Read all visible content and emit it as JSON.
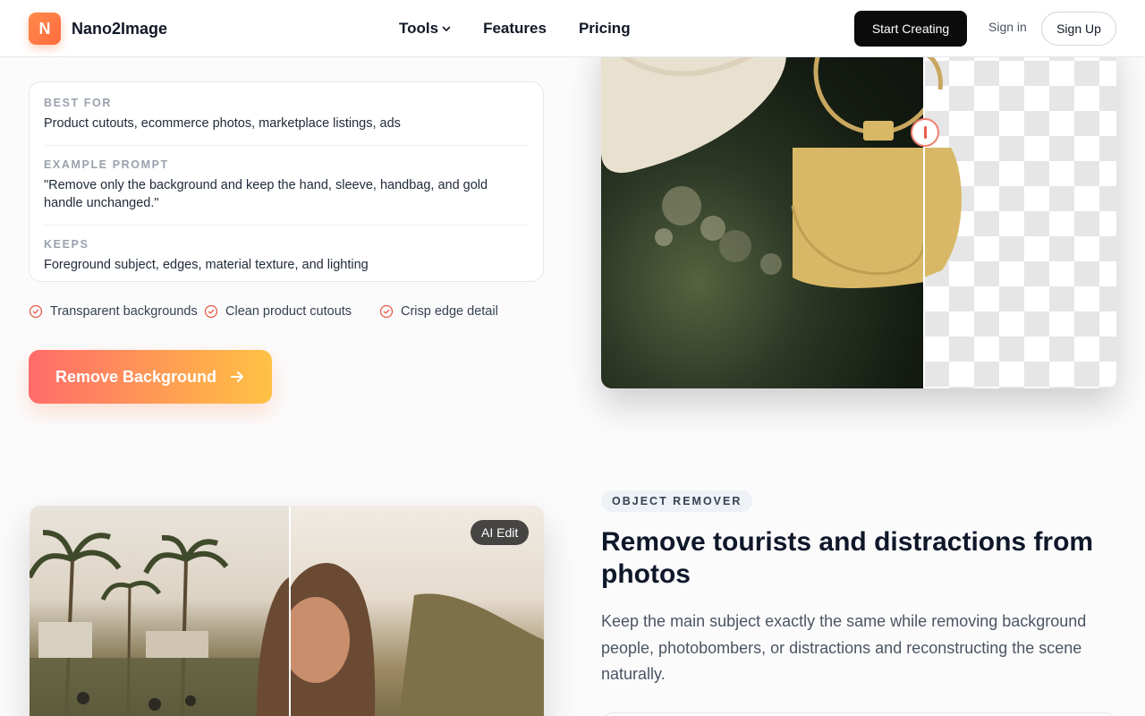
{
  "header": {
    "logo_letter": "N",
    "brand": "Nano2Image",
    "nav": [
      {
        "label": "Tools"
      },
      {
        "label": "Features"
      },
      {
        "label": "Pricing"
      }
    ],
    "start_label": "Start Creating",
    "signin_label": "Sign in",
    "signup_label": "Sign Up"
  },
  "info": {
    "rows": [
      {
        "label": "BEST FOR",
        "value": "Product cutouts, ecommerce photos, marketplace listings, ads"
      },
      {
        "label": "EXAMPLE PROMPT",
        "value": "\"Remove only the background and keep the hand, sleeve, handbag, and gold handle unchanged.\""
      },
      {
        "label": "KEEPS",
        "value": "Foreground subject, edges, material texture, and lighting"
      }
    ]
  },
  "features": [
    "Transparent backgrounds",
    "Clean product cutouts",
    "Crisp edge detail"
  ],
  "cta_label": "Remove Background",
  "beach": {
    "badge": "AI Edit"
  },
  "section": {
    "badge": "OBJECT REMOVER",
    "title": "Remove tourists and distractions from photos",
    "description": "Keep the main subject exactly the same while removing background people, photobombers, or distractions and reconstructing the scene naturally."
  },
  "colors": {
    "accent": "#ff6b3d",
    "check": "#e85d4a",
    "dark_button": "#0b0b0b"
  }
}
